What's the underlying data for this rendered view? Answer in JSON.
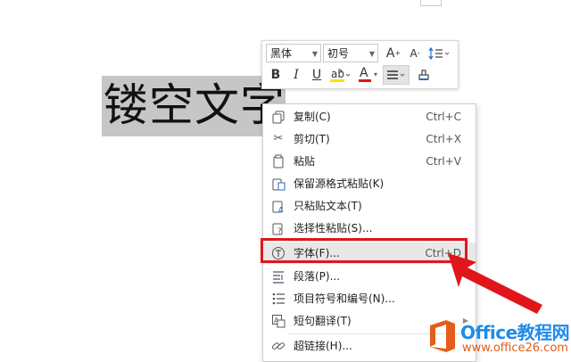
{
  "document": {
    "selected_text": "镂空文字"
  },
  "toolbar": {
    "font_name": "黑体",
    "font_size": "初号",
    "grow_font": "A",
    "shrink_font": "A",
    "bold": "B",
    "italic": "I",
    "underline": "U",
    "font_color": "A"
  },
  "context_menu": {
    "items": [
      {
        "label": "复制(C)",
        "shortcut": "Ctrl+C",
        "icon": "copy-icon"
      },
      {
        "label": "剪切(T)",
        "shortcut": "Ctrl+X",
        "icon": "scissors-icon"
      },
      {
        "label": "粘贴",
        "shortcut": "Ctrl+V",
        "icon": "paste-icon"
      },
      {
        "label": "保留源格式粘贴(K)",
        "shortcut": "",
        "icon": "paste-keep-format-icon"
      },
      {
        "label": "只粘贴文本(T)",
        "shortcut": "",
        "icon": "paste-text-icon"
      },
      {
        "label": "选择性粘贴(S)...",
        "shortcut": "",
        "icon": "paste-special-icon"
      },
      {
        "label": "字体(F)...",
        "shortcut": "Ctrl+D",
        "icon": "font-icon"
      },
      {
        "label": "段落(P)...",
        "shortcut": "",
        "icon": "paragraph-icon"
      },
      {
        "label": "项目符号和编号(N)...",
        "shortcut": "",
        "icon": "bullets-icon"
      },
      {
        "label": "短句翻译(T)",
        "shortcut": "",
        "icon": "translate-icon"
      },
      {
        "label": "超链接(H)...",
        "shortcut": "",
        "icon": "link-icon"
      }
    ]
  },
  "watermark": {
    "title": "Office教程网",
    "url": "www.office26.com"
  },
  "colors": {
    "highlight": "#e0161b",
    "selection": "#c6c6c6",
    "brand": "#1e8be8",
    "brand_orange": "#e05c1a"
  }
}
